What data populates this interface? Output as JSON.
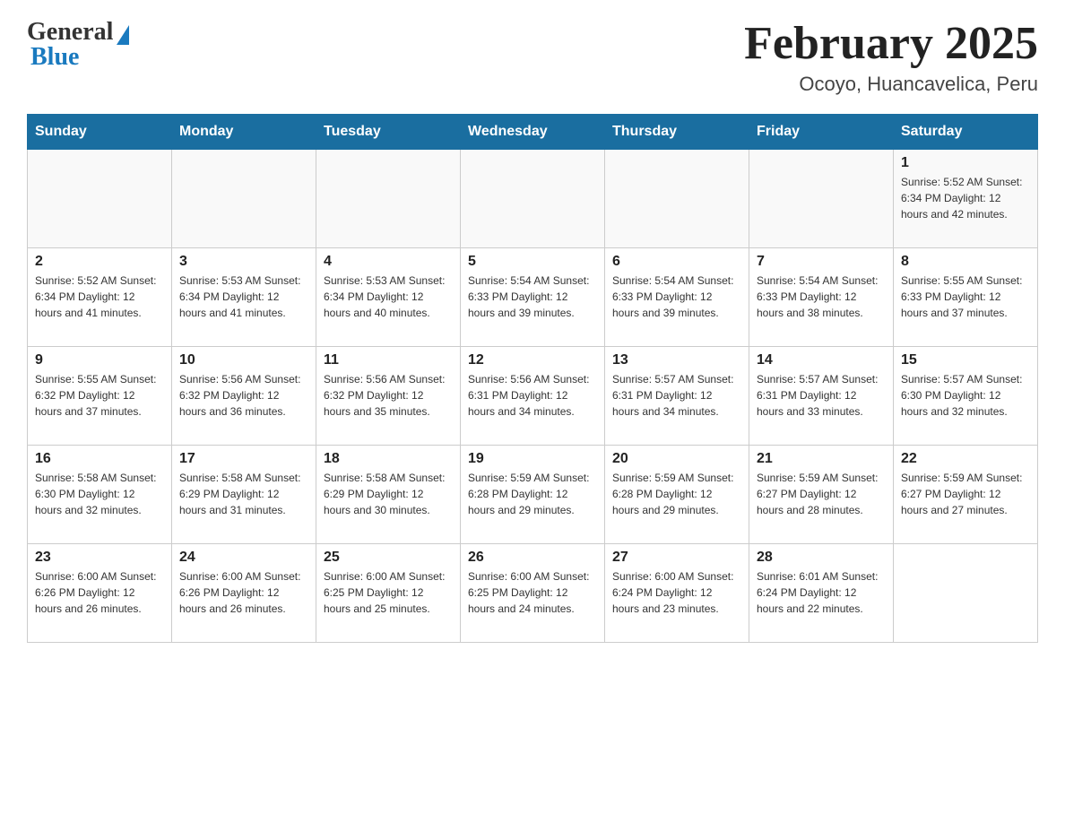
{
  "header": {
    "logo_general": "General",
    "logo_blue": "Blue",
    "month_title": "February 2025",
    "location": "Ocoyo, Huancavelica, Peru"
  },
  "days_of_week": [
    "Sunday",
    "Monday",
    "Tuesday",
    "Wednesday",
    "Thursday",
    "Friday",
    "Saturday"
  ],
  "weeks": [
    [
      {
        "day": "",
        "info": ""
      },
      {
        "day": "",
        "info": ""
      },
      {
        "day": "",
        "info": ""
      },
      {
        "day": "",
        "info": ""
      },
      {
        "day": "",
        "info": ""
      },
      {
        "day": "",
        "info": ""
      },
      {
        "day": "1",
        "info": "Sunrise: 5:52 AM\nSunset: 6:34 PM\nDaylight: 12 hours and 42 minutes."
      }
    ],
    [
      {
        "day": "2",
        "info": "Sunrise: 5:52 AM\nSunset: 6:34 PM\nDaylight: 12 hours and 41 minutes."
      },
      {
        "day": "3",
        "info": "Sunrise: 5:53 AM\nSunset: 6:34 PM\nDaylight: 12 hours and 41 minutes."
      },
      {
        "day": "4",
        "info": "Sunrise: 5:53 AM\nSunset: 6:34 PM\nDaylight: 12 hours and 40 minutes."
      },
      {
        "day": "5",
        "info": "Sunrise: 5:54 AM\nSunset: 6:33 PM\nDaylight: 12 hours and 39 minutes."
      },
      {
        "day": "6",
        "info": "Sunrise: 5:54 AM\nSunset: 6:33 PM\nDaylight: 12 hours and 39 minutes."
      },
      {
        "day": "7",
        "info": "Sunrise: 5:54 AM\nSunset: 6:33 PM\nDaylight: 12 hours and 38 minutes."
      },
      {
        "day": "8",
        "info": "Sunrise: 5:55 AM\nSunset: 6:33 PM\nDaylight: 12 hours and 37 minutes."
      }
    ],
    [
      {
        "day": "9",
        "info": "Sunrise: 5:55 AM\nSunset: 6:32 PM\nDaylight: 12 hours and 37 minutes."
      },
      {
        "day": "10",
        "info": "Sunrise: 5:56 AM\nSunset: 6:32 PM\nDaylight: 12 hours and 36 minutes."
      },
      {
        "day": "11",
        "info": "Sunrise: 5:56 AM\nSunset: 6:32 PM\nDaylight: 12 hours and 35 minutes."
      },
      {
        "day": "12",
        "info": "Sunrise: 5:56 AM\nSunset: 6:31 PM\nDaylight: 12 hours and 34 minutes."
      },
      {
        "day": "13",
        "info": "Sunrise: 5:57 AM\nSunset: 6:31 PM\nDaylight: 12 hours and 34 minutes."
      },
      {
        "day": "14",
        "info": "Sunrise: 5:57 AM\nSunset: 6:31 PM\nDaylight: 12 hours and 33 minutes."
      },
      {
        "day": "15",
        "info": "Sunrise: 5:57 AM\nSunset: 6:30 PM\nDaylight: 12 hours and 32 minutes."
      }
    ],
    [
      {
        "day": "16",
        "info": "Sunrise: 5:58 AM\nSunset: 6:30 PM\nDaylight: 12 hours and 32 minutes."
      },
      {
        "day": "17",
        "info": "Sunrise: 5:58 AM\nSunset: 6:29 PM\nDaylight: 12 hours and 31 minutes."
      },
      {
        "day": "18",
        "info": "Sunrise: 5:58 AM\nSunset: 6:29 PM\nDaylight: 12 hours and 30 minutes."
      },
      {
        "day": "19",
        "info": "Sunrise: 5:59 AM\nSunset: 6:28 PM\nDaylight: 12 hours and 29 minutes."
      },
      {
        "day": "20",
        "info": "Sunrise: 5:59 AM\nSunset: 6:28 PM\nDaylight: 12 hours and 29 minutes."
      },
      {
        "day": "21",
        "info": "Sunrise: 5:59 AM\nSunset: 6:27 PM\nDaylight: 12 hours and 28 minutes."
      },
      {
        "day": "22",
        "info": "Sunrise: 5:59 AM\nSunset: 6:27 PM\nDaylight: 12 hours and 27 minutes."
      }
    ],
    [
      {
        "day": "23",
        "info": "Sunrise: 6:00 AM\nSunset: 6:26 PM\nDaylight: 12 hours and 26 minutes."
      },
      {
        "day": "24",
        "info": "Sunrise: 6:00 AM\nSunset: 6:26 PM\nDaylight: 12 hours and 26 minutes."
      },
      {
        "day": "25",
        "info": "Sunrise: 6:00 AM\nSunset: 6:25 PM\nDaylight: 12 hours and 25 minutes."
      },
      {
        "day": "26",
        "info": "Sunrise: 6:00 AM\nSunset: 6:25 PM\nDaylight: 12 hours and 24 minutes."
      },
      {
        "day": "27",
        "info": "Sunrise: 6:00 AM\nSunset: 6:24 PM\nDaylight: 12 hours and 23 minutes."
      },
      {
        "day": "28",
        "info": "Sunrise: 6:01 AM\nSunset: 6:24 PM\nDaylight: 12 hours and 22 minutes."
      },
      {
        "day": "",
        "info": ""
      }
    ]
  ]
}
